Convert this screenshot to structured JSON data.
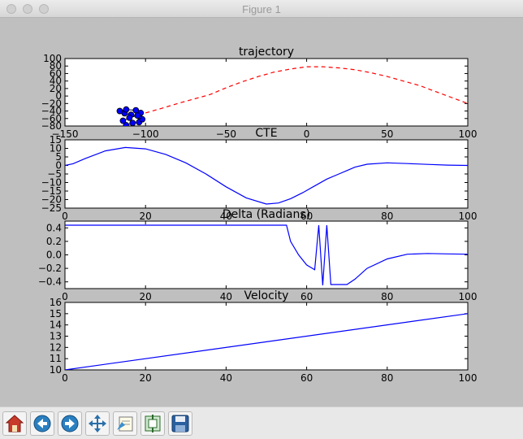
{
  "window": {
    "title": "Figure 1"
  },
  "toolbar": {
    "buttons": [
      {
        "name": "home-button",
        "icon": "home-icon"
      },
      {
        "name": "back-button",
        "icon": "back-arrow-icon"
      },
      {
        "name": "forward-button",
        "icon": "forward-arrow-icon"
      },
      {
        "name": "pan-button",
        "icon": "move-arrows-icon"
      },
      {
        "name": "zoom-button",
        "icon": "zoom-rect-icon"
      },
      {
        "name": "subplots-button",
        "icon": "subplots-icon"
      },
      {
        "name": "save-button",
        "icon": "floppy-disk-icon"
      }
    ]
  },
  "chart_data": [
    {
      "type": "line",
      "title": "trajectory",
      "xlim": [
        -150,
        100
      ],
      "ylim": [
        -80,
        100
      ],
      "xticks": [
        -150,
        -100,
        -50,
        0,
        50,
        100
      ],
      "yticks": [
        -80,
        -60,
        -40,
        -20,
        0,
        20,
        40,
        60,
        80,
        100
      ],
      "series": [
        {
          "style": "dashed",
          "color": "#ff0000",
          "x": [
            -100,
            -90,
            -80,
            -70,
            -60,
            -50,
            -40,
            -30,
            -20,
            -10,
            0,
            10,
            20,
            30,
            40,
            50,
            60,
            70,
            80,
            90,
            100
          ],
          "y": [
            -45,
            -33,
            -20,
            -8,
            4,
            22,
            38,
            52,
            64,
            72,
            78,
            78,
            75,
            70,
            62,
            52,
            40,
            28,
            12,
            -4,
            -20
          ]
        },
        {
          "style": "markers",
          "color": "#0000ff",
          "x": [
            -112,
            -108,
            -104,
            -102,
            -104,
            -109,
            -113,
            -116,
            -112,
            -106,
            -103,
            -105,
            -110,
            -114
          ],
          "y": [
            -78,
            -72,
            -70,
            -62,
            -54,
            -50,
            -46,
            -40,
            -36,
            -38,
            -45,
            -52,
            -58,
            -66
          ]
        }
      ]
    },
    {
      "type": "line",
      "title": "CTE",
      "xlim": [
        0,
        100
      ],
      "ylim": [
        -25,
        15
      ],
      "xticks": [
        0,
        20,
        40,
        60,
        80,
        100
      ],
      "yticks": [
        -25,
        -20,
        -15,
        -10,
        -5,
        0,
        5,
        10,
        15
      ],
      "series": [
        {
          "color": "#0000ff",
          "x": [
            0,
            2,
            5,
            10,
            15,
            20,
            25,
            30,
            35,
            40,
            45,
            50,
            53,
            56,
            59,
            62,
            65,
            68,
            70,
            72,
            75,
            80,
            85,
            90,
            95,
            100
          ],
          "y": [
            0,
            1,
            4,
            8.5,
            10.5,
            9.7,
            6.5,
            1.5,
            -5,
            -12.5,
            -19,
            -22.6,
            -22,
            -19.5,
            -16,
            -12,
            -8,
            -5,
            -3,
            -1,
            0.7,
            1.5,
            1.1,
            0.6,
            0.2,
            0
          ]
        }
      ]
    },
    {
      "type": "line",
      "title": "Delta (Radians)",
      "xlim": [
        0,
        100
      ],
      "ylim": [
        -0.5,
        0.5
      ],
      "xticks": [
        0,
        20,
        40,
        60,
        80,
        100
      ],
      "yticks": [
        -0.4,
        -0.2,
        0.0,
        0.2,
        0.4
      ],
      "ytick_labels": [
        "−0.4",
        "−0.2",
        "0.0",
        "0.2",
        "0.4"
      ],
      "series": [
        {
          "color": "#0000ff",
          "x": [
            0,
            20,
            40,
            55,
            56,
            58,
            60,
            62,
            63,
            64,
            65,
            66,
            67,
            68,
            70,
            72,
            75,
            80,
            85,
            90,
            95,
            100
          ],
          "y": [
            0.44,
            0.44,
            0.44,
            0.44,
            0.2,
            0.0,
            -0.15,
            -0.22,
            0.44,
            -0.45,
            0.44,
            -0.44,
            -0.44,
            -0.44,
            -0.44,
            -0.36,
            -0.2,
            -0.06,
            0.01,
            0.02,
            0.015,
            0.01
          ]
        }
      ]
    },
    {
      "type": "line",
      "title": "Velocity",
      "xlim": [
        0,
        100
      ],
      "ylim": [
        10,
        16
      ],
      "xticks": [
        0,
        20,
        40,
        60,
        80,
        100
      ],
      "yticks": [
        10,
        11,
        12,
        13,
        14,
        15,
        16
      ],
      "series": [
        {
          "color": "#0000ff",
          "x": [
            0,
            100
          ],
          "y": [
            10,
            15
          ]
        }
      ]
    }
  ]
}
